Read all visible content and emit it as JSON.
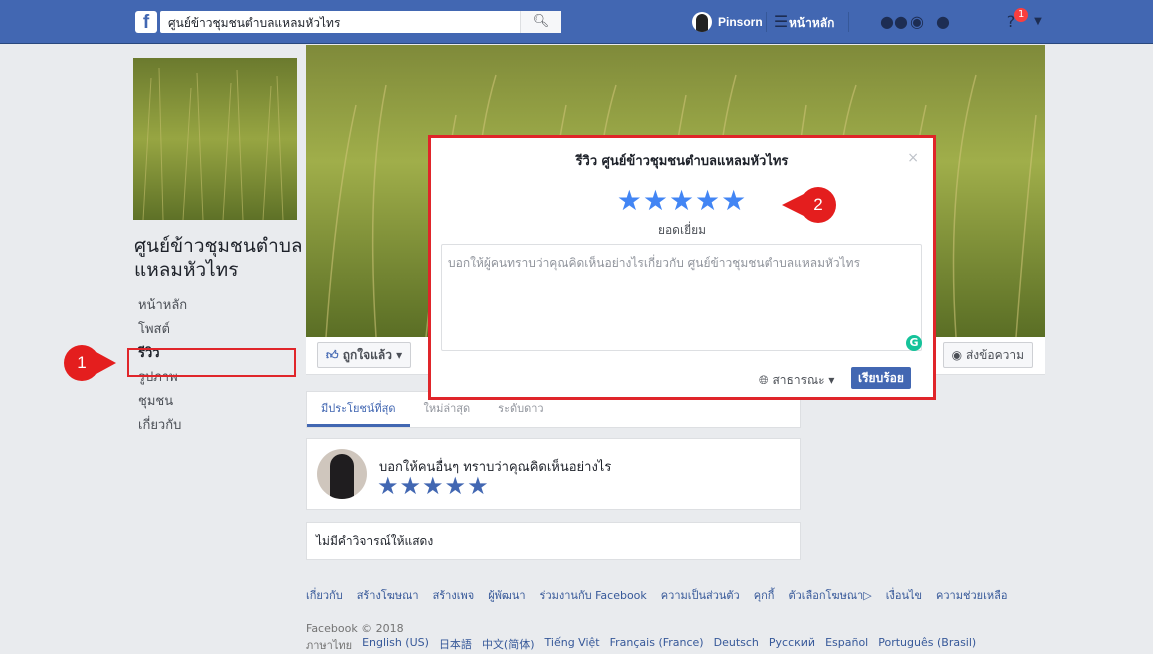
{
  "topbar": {
    "logo_letter": "f",
    "search_value": "ศูนย์ข้าวชุมชนตำบลแหลมหัวไทร",
    "user_name": "Pinsorn",
    "home_label": "หน้าหลัก",
    "notification_count": "1"
  },
  "sidebar": {
    "page_name": "ศูนย์ข้าวชุมชนตำบลแหลมหัวไทร",
    "items": [
      {
        "label": "หน้าหลัก"
      },
      {
        "label": "โพสต์"
      },
      {
        "label": "รีวิว"
      },
      {
        "label": "รูปภาพ"
      },
      {
        "label": "ชุมชน"
      },
      {
        "label": "เกี่ยวกับ"
      }
    ]
  },
  "callouts": {
    "one": "1",
    "two": "2"
  },
  "actions": {
    "like_label": "ถูกใจแล้ว ▾",
    "message_label": "ส่งข้อความ"
  },
  "tabs": [
    {
      "label": "มีประโยชน์ที่สุด"
    },
    {
      "label": "ใหม่ล่าสุด"
    },
    {
      "label": "ระดับดาว"
    }
  ],
  "review_prompt": {
    "text": "บอกให้คนอื่นๆ ทราบว่าคุณคิดเห็นอย่างไร",
    "stars": "★★★★★"
  },
  "empty_state": "ไม่มีคำวิจารณ์ให้แสดง",
  "footer": {
    "links": [
      "เกี่ยวกับ",
      "สร้างโฆษณา",
      "สร้างเพจ",
      "ผู้พัฒนา",
      "ร่วมงานกับ Facebook",
      "ความเป็นส่วนตัว",
      "คุกกี้",
      "ตัวเลือกโฆษณา▷",
      "เงื่อนไข",
      "ความช่วยเหลือ"
    ],
    "copyright": "Facebook © 2018",
    "current_language": "ภาษาไทย",
    "languages": [
      "English (US)",
      "日本語",
      "中文(简体)",
      "Tiếng Việt",
      "Français (France)",
      "Deutsch",
      "Русский",
      "Español",
      "Português (Brasil)"
    ]
  },
  "modal": {
    "title": "รีวิว ศูนย์ข้าวชุมชนตำบลแหลมหัวไทร",
    "close": "×",
    "stars": "★★★★★",
    "rating_label": "ยอดเยี่ยม",
    "placeholder": "บอกให้ผู้คนทราบว่าคุณคิดเห็นอย่างไรเกี่ยวกับ ศูนย์ข้าวชุมชนตำบลแหลมหัวไทร",
    "privacy_label": "สาธารณะ ▾",
    "submit_label": "เรียบร้อย"
  },
  "colors": {
    "brand": "#4267b2",
    "highlight": "#e0252a",
    "star": "#4285f4"
  }
}
